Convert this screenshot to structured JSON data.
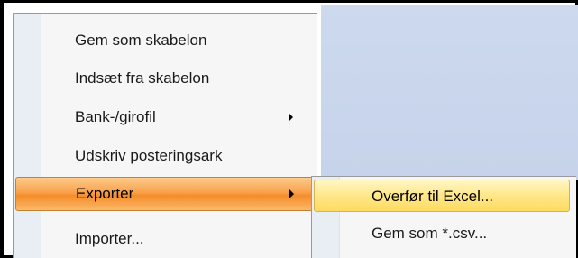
{
  "context_menu": {
    "items": [
      {
        "label": "Gem som skabelon",
        "has_submenu": false
      },
      {
        "label": "Indsæt fra skabelon",
        "has_submenu": false
      },
      {
        "label": "Bank-/girofil",
        "has_submenu": true
      },
      {
        "label": "Udskriv posteringsark",
        "has_submenu": false
      },
      {
        "label": "Exporter",
        "has_submenu": true,
        "highlighted": true
      },
      {
        "label": "Importer...",
        "has_submenu": false
      }
    ]
  },
  "submenu": {
    "items": [
      {
        "label": "Overfør til Excel...",
        "highlighted": true
      },
      {
        "label": "Gem som *.csv..."
      }
    ]
  },
  "colors": {
    "highlight_main": "#f8a24c",
    "highlight_sub": "#ffe788",
    "menu_background": "#f6f6f6",
    "gutter": "#e9eef4",
    "window_background": "#ccd9ee"
  }
}
